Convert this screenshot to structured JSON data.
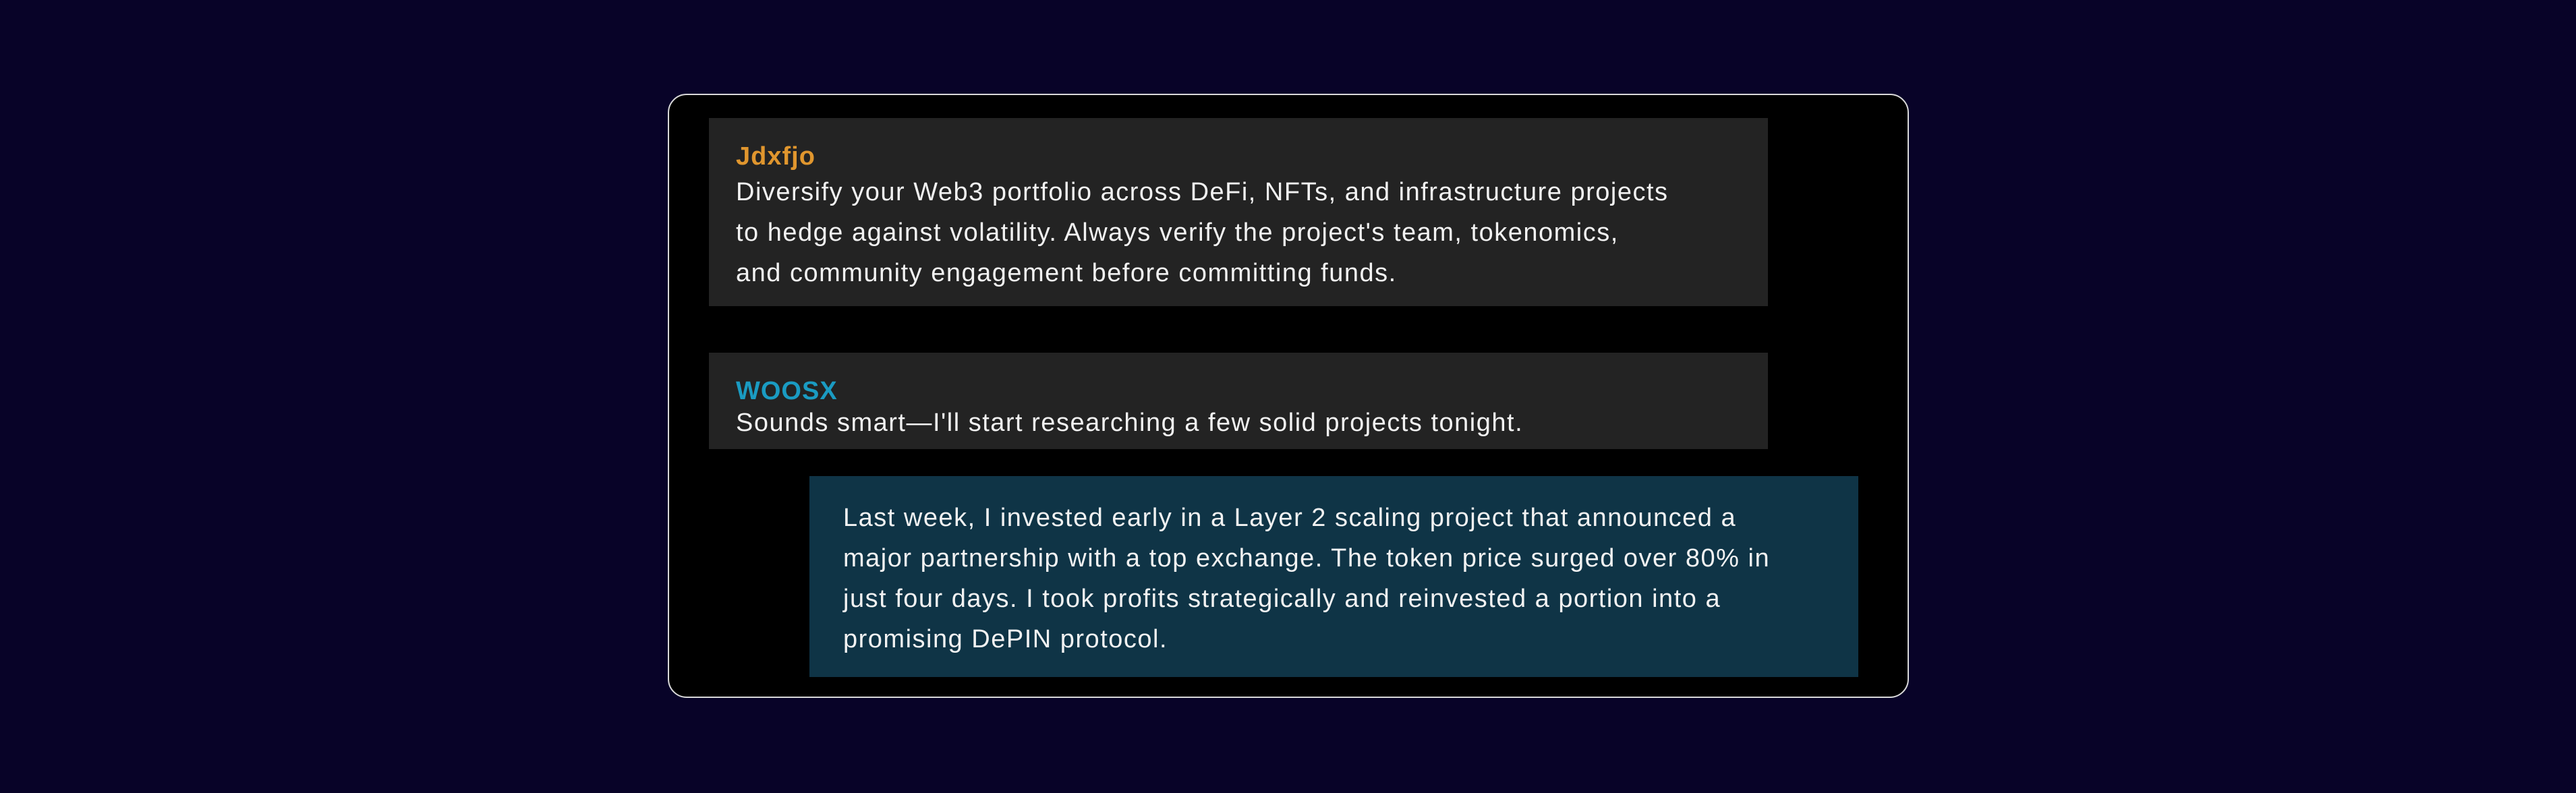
{
  "messages": [
    {
      "author": "Jdxfjo",
      "author_color": "#e0962e",
      "text": "Diversify your Web3 portfolio across DeFi, NFTs, and infrastructure projects\nto hedge against volatility. Always verify the project's team, tokenomics,\nand community engagement before committing funds."
    },
    {
      "author": "WOOSX",
      "author_color": "#1a9bc2",
      "text": "Sounds smart—I'll start researching a few solid projects tonight."
    },
    {
      "text": "Last week, I invested early in a Layer 2 scaling project that announced a\nmajor partnership with a top exchange. The token price surged over 80% in\njust four days. I took profits strategically and reinvested a portion into a\npromising DePIN protocol."
    }
  ],
  "colors": {
    "page_background": "#080328",
    "window_background": "#000000",
    "incoming_bubble": "#232323",
    "outgoing_bubble": "#0f3446",
    "text": "#f2f2f2"
  }
}
